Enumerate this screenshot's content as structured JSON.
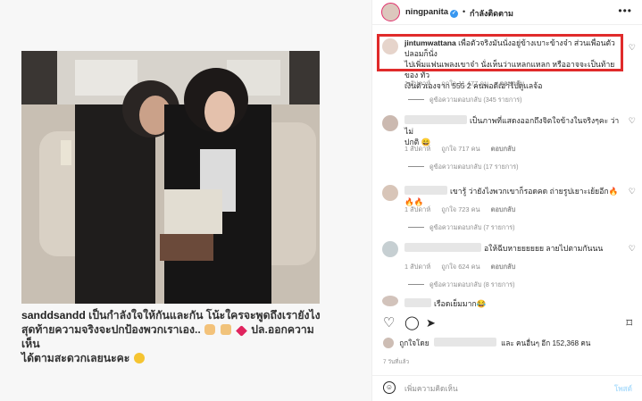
{
  "post": {
    "caption_user": "sanddsandd",
    "caption_line1": "เป็นกำลังใจให้กันและกัน โน้ะใครจะพูดถึงเรายังไง",
    "caption_line2": "สุดท้ายความจริงจะปกป้องพวกเราเอง..",
    "caption_line3": "ปล.ออกความเห็น",
    "caption_line4": "ได้ตามสะดวกเลยนะคะ"
  },
  "header": {
    "username": "ningpanita",
    "verified_mark": "✓",
    "separator": "•",
    "follow_status": "กำลังติดตาม",
    "more_icon": "more-horizontal-icon"
  },
  "comments": [
    {
      "user": "jintumwattana",
      "text_line1": "เพื่อตัวจริงมันนั่งอยู่ข้างเบาะข้างจ๋า ส่วนเพื่อนตัวปลอมก็นั่ง",
      "text_line2": "ไปเพิ่มแฟนเพลงเขาจ๋า นั่งเห็นว่าแหลกแหลก หรืออาจจะเป็นท้ายของ ทั่ว",
      "text_line3": "เงินตัวเองจาก 555 2 คนพอดีเอาไปดูแลจ้อ",
      "time": "1 สัปดาห์",
      "likes": "ถูกใจ 11,477 คน",
      "reply": "ตอบกลับ",
      "replies": "ดูข้อความตอบกลับ (345 รายการ)"
    },
    {
      "user": "",
      "text_line1": "เป็นภาพที่แสดงออกถึงจิตใจข้างในจริงๆคะ ว่าไม่",
      "text_line2": "ปกติ 😄",
      "time": "1 สัปดาห์",
      "likes": "ถูกใจ 717 คน",
      "reply": "ตอบกลับ",
      "replies": "ดูข้อความตอบกลับ (17 รายการ)"
    },
    {
      "user": "",
      "text_line1": "เขารู้ ว่ายังไงพวกเขาก็รอดคด ถ่ายรูปเยาะเย้ยอีก🔥🔥🔥",
      "time": "1 สัปดาห์",
      "likes": "ถูกใจ 723 คน",
      "reply": "ตอบกลับ",
      "replies": "ดูข้อความตอบกลับ (7 รายการ)"
    },
    {
      "user": "",
      "text_line1": "อให้ฉีบหายยยยยย ลายไปตามกันนน",
      "time": "1 สัปดาห์",
      "likes": "ถูกใจ 624 คน",
      "reply": "ตอบกลับ",
      "replies": "ดูข้อความตอบกลับ (8 รายการ)"
    },
    {
      "user": "",
      "text_line1": "เรือดเย็มมาก😂"
    }
  ],
  "actions": {
    "like_icon": "heart-icon",
    "comment_icon": "comment-icon",
    "share_icon": "send-icon",
    "save_icon": "bookmark-icon"
  },
  "likes_summary": {
    "prefix": "ถูกใจโดย",
    "suffix": "และ คนอื่นๆ อีก 152,368 คน"
  },
  "time_ago": "7 วันที่แล้ว",
  "add_comment": {
    "placeholder": "เพิ่มความคิดเห็น",
    "post_label": "โพสต์"
  },
  "colors": {
    "highlight": "#e02b2b",
    "verified": "#3897f0",
    "post_button": "#b2dffc"
  }
}
